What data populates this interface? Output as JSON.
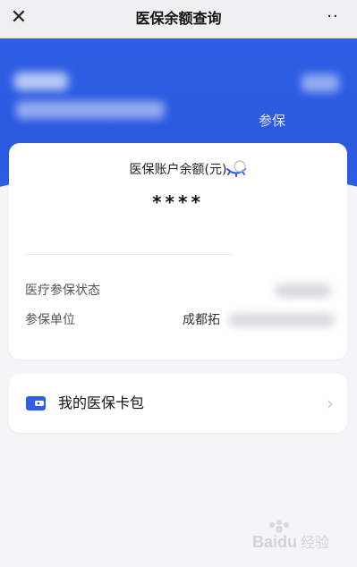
{
  "nav": {
    "close_glyph": "✕",
    "title": "医保余额查询",
    "more_glyph": "··"
  },
  "hero": {
    "right_label": "参保"
  },
  "balance": {
    "label": "医保账户余额(元)",
    "value": "****"
  },
  "details": {
    "rows": [
      {
        "label": "医疗参保状态"
      },
      {
        "label": "参保单位",
        "value_visible": "成都拓"
      }
    ]
  },
  "wallet": {
    "label": "我的医保卡包",
    "chevron_glyph": "›"
  },
  "watermark": {
    "text": "Baidu经验"
  },
  "colors": {
    "brand_blue": "#2f5fe6",
    "page_bg": "#f4f5f7",
    "card_bg": "#ffffff"
  },
  "icons": {
    "close": "close-icon",
    "more": "more-icon",
    "eye": "eye-closed-icon",
    "wallet": "wallet-icon",
    "chevron": "chevron-right-icon"
  }
}
